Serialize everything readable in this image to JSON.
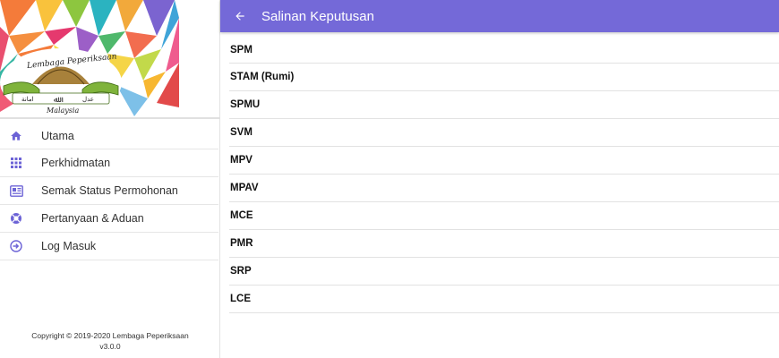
{
  "sidebar": {
    "logo": {
      "text_top": "Lembaga Peperiksaan",
      "text_bottom": "Malaysia",
      "jawi_left": "امانة",
      "jawi_right": "عدل"
    },
    "items": [
      {
        "label": "Utama",
        "icon": "home-icon"
      },
      {
        "label": "Perkhidmatan",
        "icon": "apps-grid-icon"
      },
      {
        "label": "Semak Status Permohonan",
        "icon": "newspaper-icon"
      },
      {
        "label": "Pertanyaan & Aduan",
        "icon": "lifebuoy-icon"
      },
      {
        "label": "Log Masuk",
        "icon": "login-icon"
      }
    ],
    "footer": {
      "copyright": "Copyright © 2019-2020 Lembaga Peperiksaan",
      "version": "v3.0.0"
    }
  },
  "appbar": {
    "title": "Salinan Keputusan",
    "back_icon": "arrow-back-icon",
    "color": "#7469d8"
  },
  "list": {
    "items": [
      "SPM",
      "STAM (Rumi)",
      "SPMU",
      "SVM",
      "MPV",
      "MPAV",
      "MCE",
      "PMR",
      "SRP",
      "LCE"
    ]
  },
  "colors": {
    "accent": "#6c63d6",
    "divider": "#e2e2e2"
  }
}
